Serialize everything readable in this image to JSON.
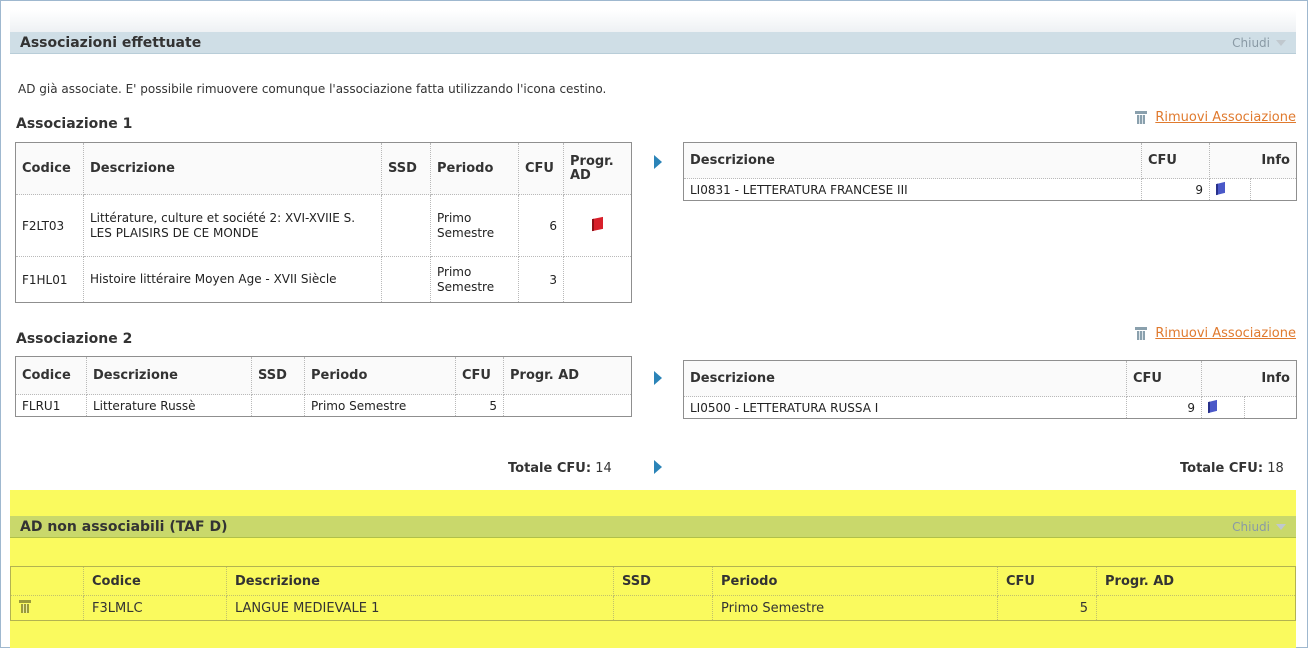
{
  "section1": {
    "title": "Associazioni effettuate",
    "close_label": "Chiudi"
  },
  "intro_text": "AD già associate. E' possibile rimuovere comunque l'associazione fatta utilizzando l'icona cestino.",
  "remove_label": "Rimuovi Associazione",
  "assoc1": {
    "title": "Associazione 1",
    "left_headers": {
      "codice": "Codice",
      "descrizione": "Descrizione",
      "ssd": "SSD",
      "periodo": "Periodo",
      "cfu": "CFU",
      "progr": "Progr. AD"
    },
    "left_rows": [
      {
        "codice": "F2LT03",
        "descrizione": "Littérature, culture et société 2: XVI-XVIIE S. LES PLAISIRS DE CE MONDE",
        "ssd": "",
        "periodo": "Primo Semestre",
        "cfu": "6",
        "progr_icon": "book-icon"
      },
      {
        "codice": "F1HL01",
        "descrizione": "Histoire littéraire Moyen Age - XVII Siècle",
        "ssd": "",
        "periodo": "Primo Semestre",
        "cfu": "3",
        "progr_icon": ""
      }
    ],
    "right_headers": {
      "descrizione": "Descrizione",
      "cfu": "CFU",
      "info": "Info"
    },
    "right_rows": [
      {
        "descrizione": "LI0831 - LETTERATURA FRANCESE III",
        "cfu": "9",
        "info_icon": "book-icon"
      }
    ]
  },
  "assoc2": {
    "title": "Associazione 2",
    "left_headers": {
      "codice": "Codice",
      "descrizione": "Descrizione",
      "ssd": "SSD",
      "periodo": "Periodo",
      "cfu": "CFU",
      "progr": "Progr. AD"
    },
    "left_rows": [
      {
        "codice": "FLRU1",
        "descrizione": "Litterature Russè",
        "ssd": "",
        "periodo": "Primo Semestre",
        "cfu": "5"
      }
    ],
    "right_headers": {
      "descrizione": "Descrizione",
      "cfu": "CFU",
      "info": "Info"
    },
    "right_rows": [
      {
        "descrizione": "LI0500 - LETTERATURA RUSSA I",
        "cfu": "9",
        "info_icon": "book-icon"
      }
    ]
  },
  "totals": {
    "label": "Totale CFU:",
    "left": "14",
    "right": "18"
  },
  "section2": {
    "title": "AD non associabili (TAF D)",
    "close_label": "Chiudi",
    "headers": {
      "codice": "Codice",
      "descrizione": "Descrizione",
      "ssd": "SSD",
      "periodo": "Periodo",
      "cfu": "CFU",
      "progr": "Progr. AD"
    },
    "rows": [
      {
        "codice": "F3LMLC",
        "descrizione": "LANGUE MEDIEVALE 1",
        "ssd": "",
        "periodo": "Primo Semestre",
        "cfu": "5",
        "progr": ""
      }
    ]
  },
  "colors": {
    "blue_bar": "#cfdee6",
    "green_bar": "#c9d86b",
    "yellow_bg": "#fafa5e",
    "link_orange": "#e07a2e",
    "arrow_blue": "#2b84b8"
  }
}
